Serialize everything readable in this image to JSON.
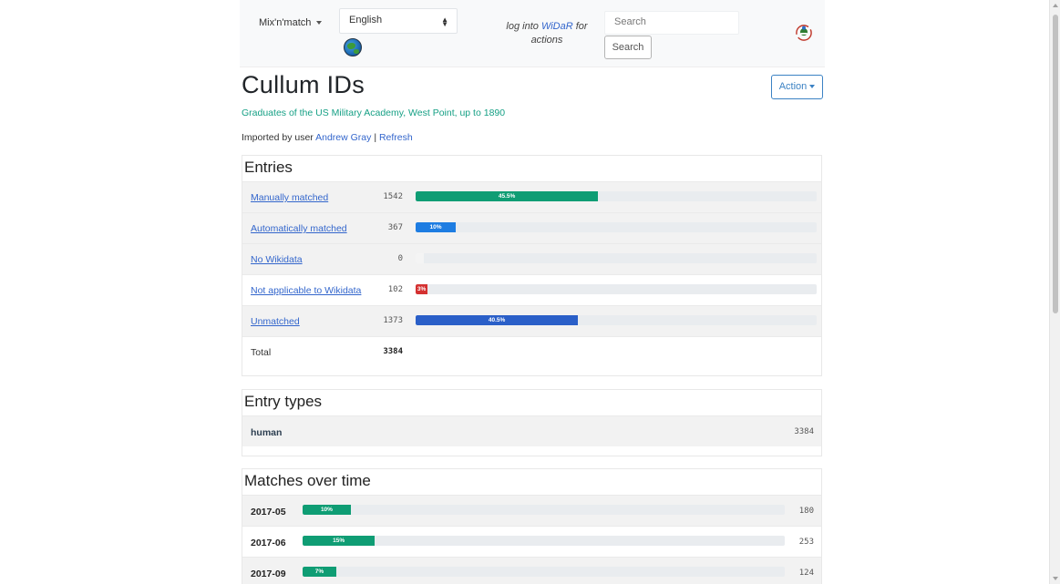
{
  "nav": {
    "brand": "Mix'n'match",
    "language": "English",
    "login_prefix": "log into ",
    "login_link": "WiDaR",
    "login_suffix": " for actions",
    "search_placeholder": "Search",
    "search_button": "Search"
  },
  "catalog": {
    "title": "Cullum IDs",
    "description": "Graduates of the US Military Academy, West Point, up to 1890",
    "imported_prefix": "Imported by user ",
    "imported_user": "Andrew Gray",
    "separator": " | ",
    "refresh": "Refresh",
    "action_label": "Action"
  },
  "entries": {
    "title": "Entries",
    "rows": [
      {
        "label": "Manually matched",
        "count": "1542",
        "pct": 45.5,
        "pct_label": "45.5%",
        "color": "#0f9d74",
        "striped": true
      },
      {
        "label": "Automatically matched",
        "count": "367",
        "pct": 10,
        "pct_label": "10%",
        "color": "#1e7de2",
        "striped": true
      },
      {
        "label": "No Wikidata",
        "count": "0",
        "pct": 0,
        "pct_label": "",
        "color": "#f4f4f4",
        "striped": true
      },
      {
        "label": "Not applicable to Wikidata",
        "count": "102",
        "pct": 3,
        "pct_label": "3%",
        "color": "#d43131",
        "striped": false
      },
      {
        "label": "Unmatched",
        "count": "1373",
        "pct": 40.5,
        "pct_label": "40.5%",
        "color": "#2a5fc8",
        "striped": true
      }
    ],
    "total_label": "Total",
    "total_count": "3384"
  },
  "entry_types": {
    "title": "Entry types",
    "rows": [
      {
        "label": "human",
        "count": "3384"
      }
    ]
  },
  "matches": {
    "title": "Matches over time",
    "color": "#0f9d74",
    "rows": [
      {
        "label": "2017-05",
        "pct": 10,
        "pct_label": "10%",
        "count": "180"
      },
      {
        "label": "2017-06",
        "pct": 15,
        "pct_label": "15%",
        "count": "253"
      },
      {
        "label": "2017-09",
        "pct": 7,
        "pct_label": "7%",
        "count": "124"
      }
    ]
  }
}
